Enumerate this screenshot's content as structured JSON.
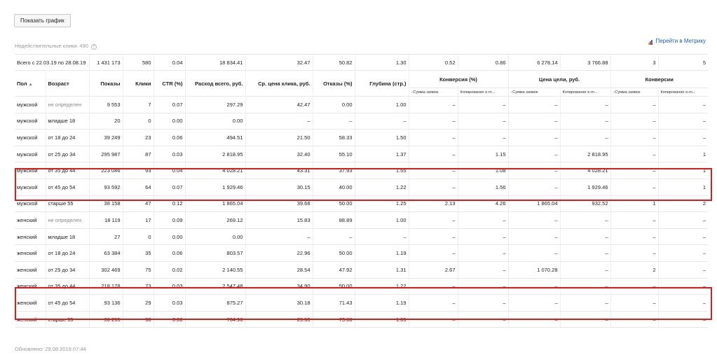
{
  "toolbar": {
    "show_chart_label": "Показать график"
  },
  "invalid_clicks": {
    "label": "Недействительные клики: 490",
    "help_glyph": "?"
  },
  "metrika": {
    "label": "Перейти в Метрику"
  },
  "table": {
    "totals": [
      "Всего с 22.03.19 по 28.08.19",
      "1 431 173",
      "580",
      "0.04",
      "18 834.41",
      "32.47",
      "50.82",
      "1.30",
      "0.52",
      "0.86",
      "6 278.14",
      "3 766.88",
      "3",
      "5"
    ],
    "headers": {
      "gender": "Пол",
      "sort_glyph": "▲",
      "age": "Возраст",
      "impressions": "Показы",
      "clicks": "Клики",
      "ctr": "CTR (%)",
      "spend": "Расход всего, руб.",
      "avg_cpc": "Ср. цена клика, руб.",
      "bounce": "Отказы (%)",
      "depth": "Глубина (стр.)",
      "conversion": "Конверсия (%)",
      "goal_price": "Цена цели, руб.",
      "conversions": "Конверсии"
    },
    "subheaders": {
      "arrow": "›",
      "sum_orders": "Сумма заявок",
      "copy_email": "Копирование е-m..."
    },
    "rows": [
      [
        "мужской",
        "не определен",
        "9 553",
        "7",
        "0.07",
        "297.29",
        "42.47",
        "0.00",
        "1.00",
        "–",
        "–",
        "–",
        "–",
        "–",
        "–"
      ],
      [
        "мужской",
        "младше 18",
        "20",
        "0",
        "0.00",
        "0.00",
        "–",
        "–",
        "–",
        "–",
        "–",
        "–",
        "–",
        "–",
        "–"
      ],
      [
        "мужской",
        "от 18 до 24",
        "39 249",
        "23",
        "0.06",
        "494.51",
        "21.50",
        "58.33",
        "1.50",
        "–",
        "–",
        "–",
        "–",
        "–",
        "–"
      ],
      [
        "мужской",
        "от 25 до 34",
        "295 987",
        "87",
        "0.03",
        "2 818.95",
        "32.40",
        "55.10",
        "1.37",
        "–",
        "1.15",
        "–",
        "2 818.95",
        "–",
        "1"
      ],
      [
        "мужской",
        "от 35 до 44",
        "223 046",
        "93",
        "0.04",
        "4 028.21",
        "43.31",
        "37.93",
        "1.55",
        "–",
        "1.08",
        "–",
        "4 028.21",
        "–",
        "1"
      ],
      [
        "мужской",
        "от 45 до 54",
        "93 592",
        "64",
        "0.07",
        "1 929.46",
        "30.15",
        "40.00",
        "1.22",
        "–",
        "1.56",
        "–",
        "1 929.46",
        "–",
        "1"
      ],
      [
        "мужской",
        "старше 55",
        "38 158",
        "47",
        "0.12",
        "1 865.04",
        "39.68",
        "50.00",
        "1.25",
        "2.13",
        "4.26",
        "1 865.04",
        "932.52",
        "1",
        "2"
      ],
      [
        "женский",
        "не определен",
        "18 119",
        "17",
        "0.09",
        "269.12",
        "15.83",
        "88.89",
        "1.00",
        "–",
        "–",
        "–",
        "–",
        "–",
        "–"
      ],
      [
        "женский",
        "младше 18",
        "27",
        "0",
        "0.00",
        "0.00",
        "–",
        "–",
        "–",
        "–",
        "–",
        "–",
        "–",
        "–",
        "–"
      ],
      [
        "женский",
        "от 18 до 24",
        "63 384",
        "35",
        "0.06",
        "803.57",
        "22.96",
        "50.00",
        "1.19",
        "–",
        "–",
        "–",
        "–",
        "–",
        "–"
      ],
      [
        "женский",
        "от 25 до 34",
        "302 469",
        "75",
        "0.02",
        "2 140.55",
        "28.54",
        "47.92",
        "1.31",
        "2.67",
        "–",
        "1 070.28",
        "–",
        "2",
        "–"
      ],
      [
        "женский",
        "от 35 до 44",
        "218 178",
        "73",
        "0.03",
        "2 547.48",
        "34.90",
        "50.00",
        "1.22",
        "–",
        "–",
        "–",
        "–",
        "–",
        "–"
      ],
      [
        "женский",
        "от 45 до 54",
        "93 136",
        "29",
        "0.03",
        "875.27",
        "30.18",
        "71.43",
        "1.19",
        "–",
        "–",
        "–",
        "–",
        "–",
        "–"
      ],
      [
        "женский",
        "старше 55",
        "36 255",
        "30",
        "0.08",
        "764.96",
        "25.50",
        "73.68",
        "1.05",
        "–",
        "–",
        "–",
        "–",
        "–",
        "–"
      ]
    ]
  },
  "footer": {
    "updated": "Обновлено: 29.08.2019 07:44"
  },
  "colors": {
    "highlight": "#e0191b",
    "link": "#1a5fb4",
    "muted": "#8a8a8a"
  }
}
